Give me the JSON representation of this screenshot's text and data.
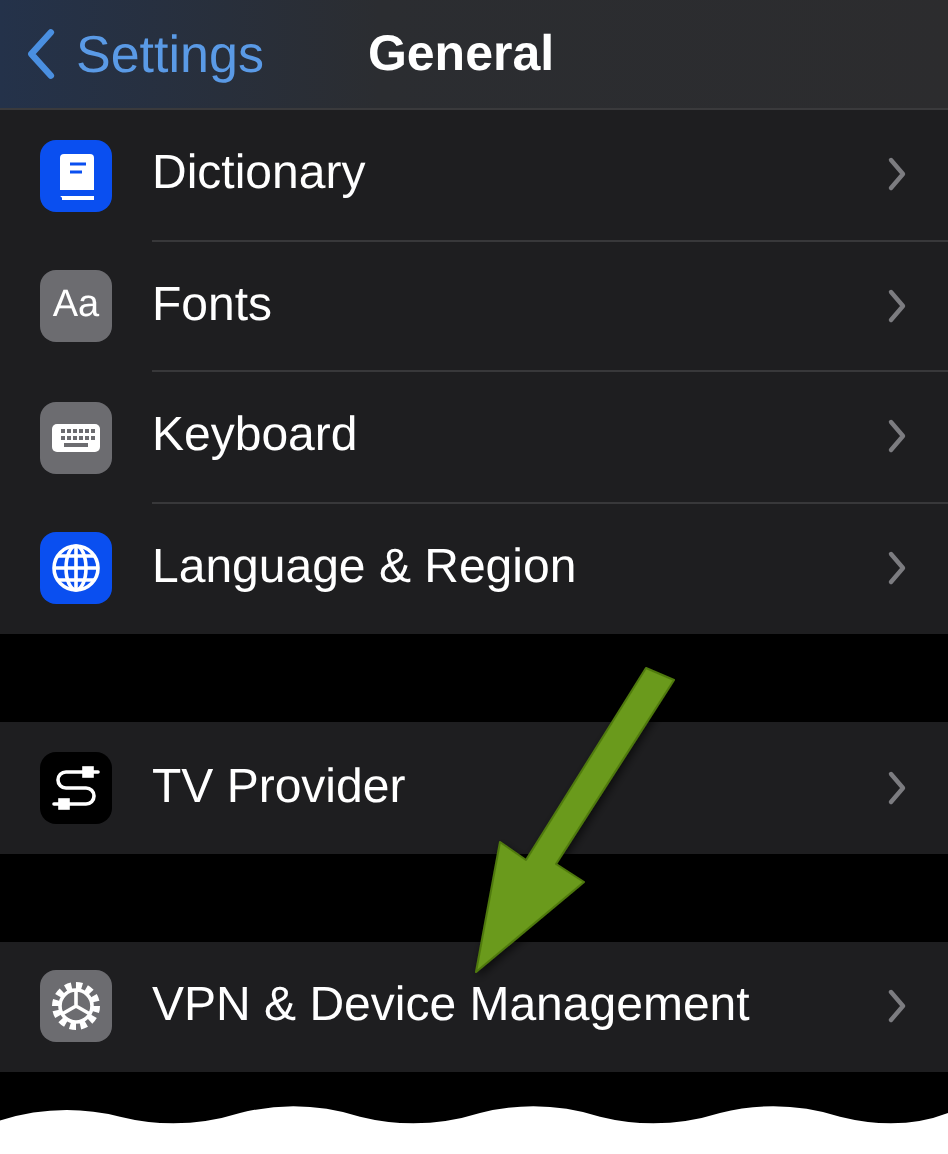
{
  "nav": {
    "back_label": "Settings",
    "title": "General"
  },
  "sections": [
    {
      "items": [
        {
          "label": "Dictionary",
          "kind": "book",
          "color": "#0a4ff0"
        },
        {
          "label": "Fonts",
          "kind": "fonts",
          "color": "#6c6c70",
          "icon_text": "Aa"
        },
        {
          "label": "Keyboard",
          "kind": "keyboard",
          "color": "#6c6c70"
        },
        {
          "label": "Language & Region",
          "kind": "globe",
          "color": "#0a4ff0"
        }
      ]
    },
    {
      "items": [
        {
          "label": "TV Provider",
          "kind": "cable",
          "color": "#000000"
        }
      ]
    },
    {
      "items": [
        {
          "label": "VPN & Device Management",
          "kind": "gear",
          "color": "#6c6c70"
        }
      ]
    }
  ]
}
